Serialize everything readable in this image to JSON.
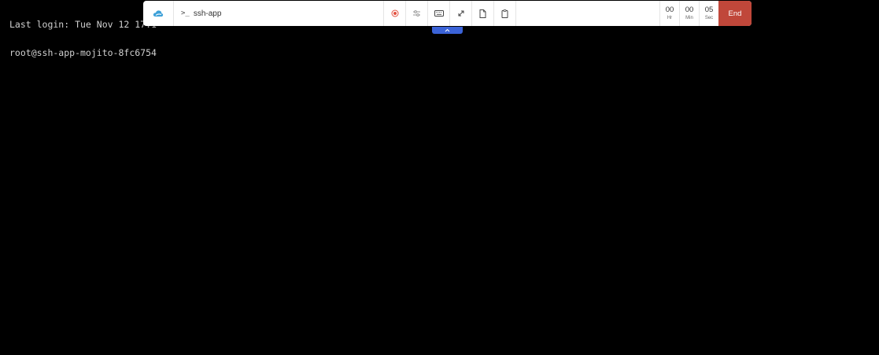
{
  "terminal": {
    "lines": [
      "Last login: Tue Nov 12 17:1",
      "root@ssh-app-mojito-8fc6754"
    ]
  },
  "toolbar": {
    "logo_icon": "cloud-logo",
    "prompt_symbol": ">_",
    "session_title": "ssh-app",
    "buttons": [
      {
        "name": "record-button",
        "icon": "record-icon"
      },
      {
        "name": "settings-button",
        "icon": "sliders-icon"
      },
      {
        "name": "keyboard-button",
        "icon": "keyboard-icon"
      },
      {
        "name": "fullscreen-button",
        "icon": "expand-icon"
      },
      {
        "name": "file-button",
        "icon": "file-icon"
      },
      {
        "name": "clipboard-button",
        "icon": "clipboard-icon"
      }
    ],
    "timer": {
      "hours": "00",
      "hours_label": "Hr",
      "minutes": "00",
      "minutes_label": "Min",
      "seconds": "05",
      "seconds_label": "Sec"
    },
    "end_label": "End"
  },
  "colors": {
    "end_button": "#c0473a",
    "collapse_tab": "#3b63d8",
    "record_icon": "#e25140",
    "logo": "#3da0d8"
  }
}
